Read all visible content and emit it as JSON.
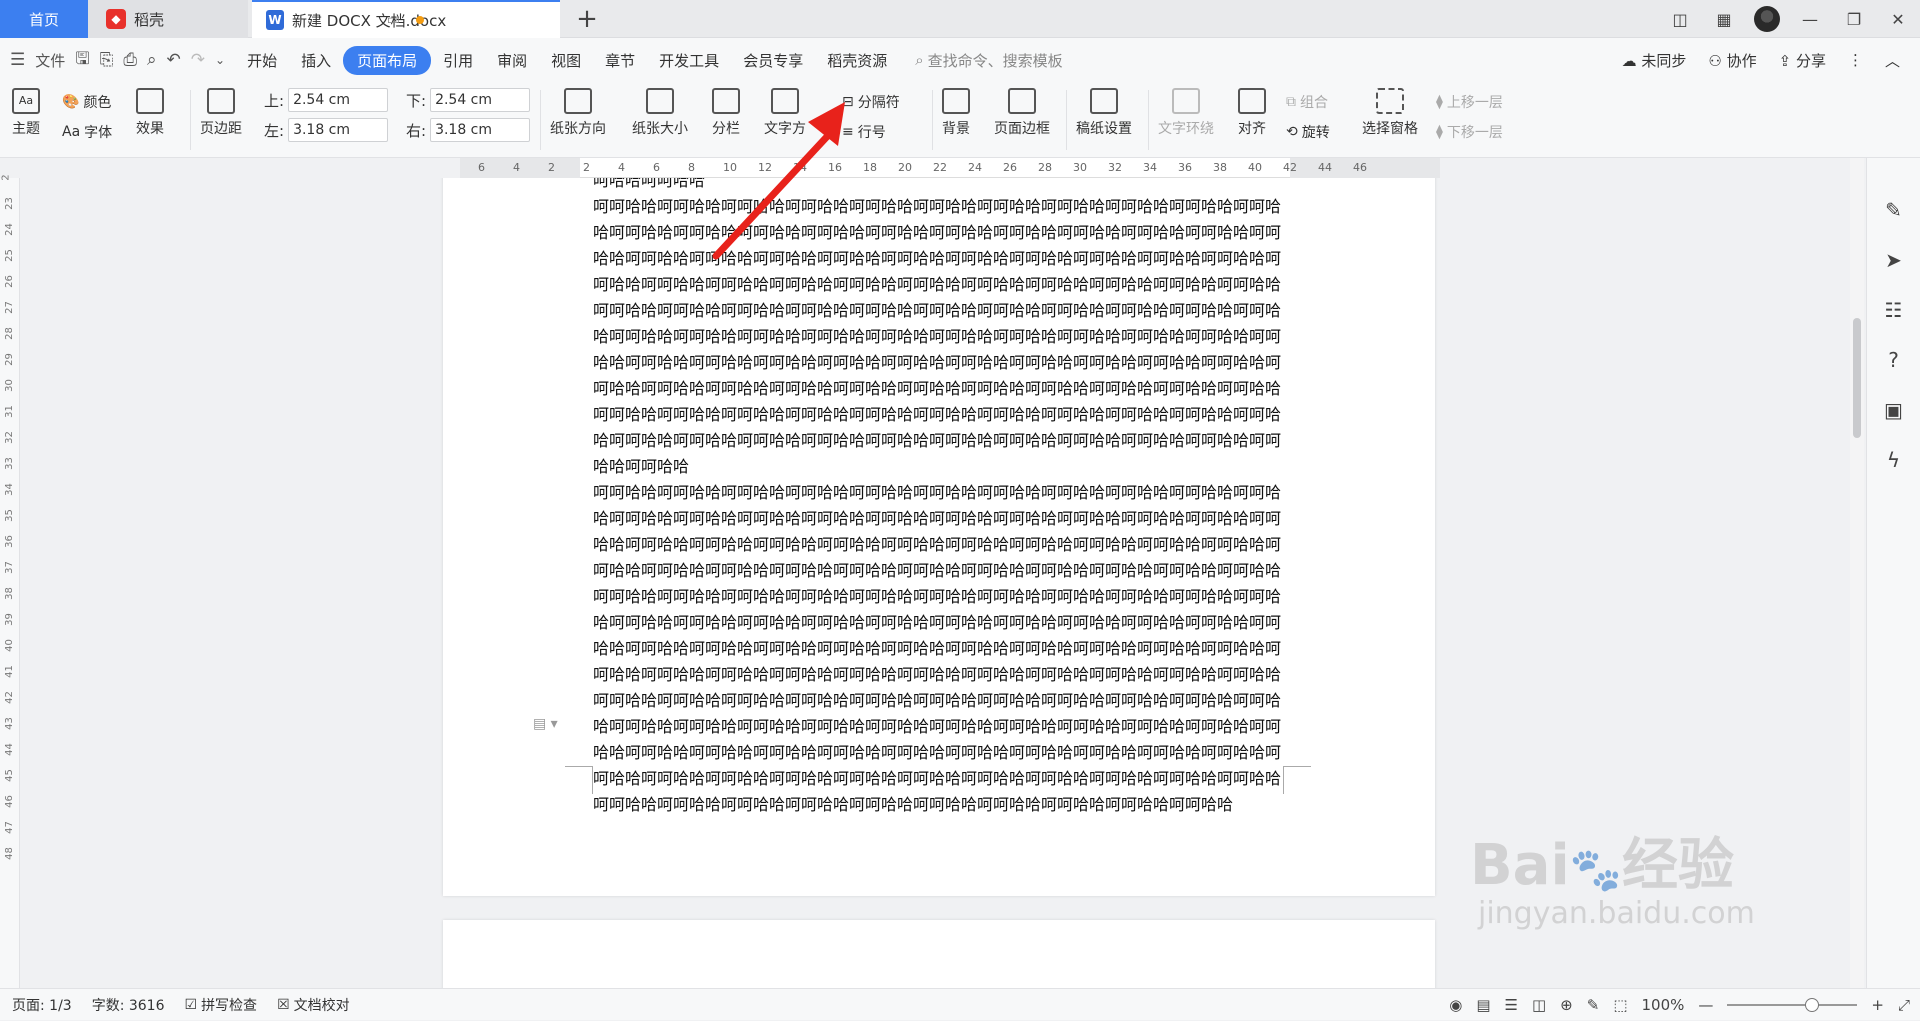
{
  "tabs": {
    "home": "首页",
    "daoke": "稻壳",
    "doc": "新建 DOCX 文档.docx",
    "add": "+"
  },
  "menu": {
    "file": "文件",
    "items": [
      "开始",
      "插入",
      "页面布局",
      "引用",
      "审阅",
      "视图",
      "章节",
      "开发工具",
      "会员专享",
      "稻壳资源"
    ],
    "active": "页面布局",
    "search_placeholder": "查找命令、搜索模板",
    "unsynced": "未同步",
    "collab": "协作",
    "share": "分享"
  },
  "ribbon": {
    "theme": "主题",
    "color": "颜色",
    "font": "字体",
    "effect": "效果",
    "margins": "页边距",
    "top_label": "上:",
    "top_value": "2.54 cm",
    "bottom_label": "下:",
    "bottom_value": "2.54 cm",
    "left_label": "左:",
    "left_value": "3.18 cm",
    "right_label": "右:",
    "right_value": "3.18 cm",
    "orientation": "纸张方向",
    "size": "纸张大小",
    "columns": "分栏",
    "text_dir": "文字方",
    "separator": "分隔符",
    "line_num": "行号",
    "background": "背景",
    "page_border": "页面边框",
    "grid_paper": "稿纸设置",
    "wrap": "文字环绕",
    "align": "对齐",
    "rotate": "旋转",
    "group": "组合",
    "select_pane": "选择窗格",
    "bring_forward": "上移一层",
    "send_backward": "下移一层"
  },
  "document": {
    "line0": "呵哈哈呵呵哈哈",
    "para1": "呵呵哈哈呵呵哈哈呵呵哈哈呵呵哈哈呵呵哈哈呵呵哈哈呵呵哈哈呵呵哈哈呵呵哈哈呵呵哈哈呵呵哈哈呵呵哈哈呵呵哈哈呵呵哈哈呵呵哈哈呵呵哈哈呵呵哈哈呵呵哈哈呵呵哈哈呵呵哈哈呵呵哈哈呵呵哈哈呵呵哈哈呵呵哈哈呵呵哈哈呵呵哈哈呵呵哈哈呵呵哈哈呵呵哈哈呵呵哈哈呵呵哈哈呵呵哈哈呵呵哈哈呵呵哈哈呵呵哈哈呵呵哈哈呵呵哈哈呵呵哈哈呵呵哈哈呵呵哈哈呵呵哈哈呵呵哈哈呵呵哈哈呵呵哈哈呵呵哈哈呵呵哈哈呵呵哈哈呵呵哈哈呵呵哈哈呵呵哈哈呵呵哈哈呵呵哈哈呵呵哈哈呵呵哈哈呵呵哈哈呵呵哈哈呵呵哈哈呵呵哈哈呵呵哈哈呵呵哈哈呵呵哈哈呵呵哈哈呵呵哈哈呵呵哈哈呵呵哈哈呵呵哈哈呵呵哈哈呵呵哈哈呵呵哈哈呵呵哈哈呵呵哈哈呵呵哈哈呵呵哈哈呵呵哈哈呵呵哈哈呵呵哈哈呵呵哈哈呵呵哈哈呵呵哈哈呵呵哈哈呵呵哈哈呵呵哈哈呵呵哈哈呵呵哈哈呵呵哈哈呵呵哈哈呵呵哈哈呵呵哈哈呵呵哈哈呵呵哈哈呵呵哈哈呵呵哈哈呵呵哈哈呵呵哈哈呵呵哈哈呵呵哈哈呵呵哈哈呵呵哈哈呵呵哈哈呵呵哈哈呵呵哈哈呵呵哈哈呵呵哈哈呵呵哈哈呵呵哈哈呵呵哈哈呵呵哈哈呵呵哈哈呵呵哈哈",
    "para2": "呵呵哈哈呵呵哈哈呵呵哈哈呵呵哈哈呵呵哈哈呵呵哈哈呵呵哈哈呵呵哈哈呵呵哈哈呵呵哈哈呵呵哈哈呵呵哈哈呵呵哈哈呵呵哈哈呵呵哈哈呵呵哈哈呵呵哈哈呵呵哈哈呵呵哈哈呵呵哈哈呵呵哈哈呵呵哈哈呵呵哈哈呵呵哈哈呵呵哈哈呵呵哈哈呵呵哈哈呵呵哈哈呵呵哈哈呵呵哈哈呵呵哈哈呵呵哈哈呵呵哈哈呵呵哈哈呵呵哈哈呵呵哈哈呵呵哈哈呵呵哈哈呵呵哈哈呵呵哈哈呵呵哈哈呵呵哈哈呵呵哈哈呵呵哈哈呵呵哈哈呵呵哈哈呵呵哈哈呵呵哈哈呵呵哈哈呵呵哈哈呵呵哈哈呵呵哈哈呵呵哈哈呵呵哈哈呵呵哈哈呵呵哈哈呵呵哈哈呵呵哈哈呵呵哈哈呵呵哈哈呵呵哈哈呵呵哈哈呵呵哈哈呵呵哈哈呵呵哈哈呵呵哈哈呵呵哈哈呵呵哈哈呵呵哈哈呵呵哈哈呵呵哈哈呵呵哈哈呵呵哈哈呵呵哈哈呵呵哈哈呵呵哈哈呵呵哈哈呵呵哈哈呵呵哈哈呵呵哈哈呵呵哈哈呵呵哈哈呵呵哈哈呵呵哈哈呵呵哈哈呵呵哈哈呵呵哈哈呵呵哈哈呵呵哈哈呵呵哈哈呵呵哈哈呵呵哈哈呵呵哈哈呵呵哈哈呵呵哈哈呵呵哈哈呵呵哈哈呵呵哈哈呵呵哈哈呵呵哈哈呵呵哈哈呵呵哈哈呵呵哈哈呵呵哈哈呵呵哈哈呵呵哈哈呵呵哈哈呵呵哈哈呵呵哈哈呵呵哈哈呵呵哈哈呵呵哈哈呵呵哈哈呵呵哈哈呵呵哈哈呵呵哈哈呵呵哈哈呵呵哈哈呵呵哈哈呵呵哈哈呵呵哈哈呵呵哈哈呵呵哈哈呵呵哈哈呵呵哈哈呵呵哈哈呵呵哈哈呵呵哈哈呵呵哈哈呵呵哈哈呵呵哈哈呵呵哈哈呵呵哈哈呵呵哈哈呵呵哈哈呵呵哈哈呵呵哈哈呵呵哈哈呵呵哈哈"
  },
  "ruler_h": [
    "6",
    "4",
    "2",
    "2",
    "4",
    "6",
    "8",
    "10",
    "12",
    "14",
    "16",
    "18",
    "20",
    "22",
    "24",
    "26",
    "28",
    "30",
    "32",
    "34",
    "36",
    "38",
    "40",
    "42",
    "44",
    "46"
  ],
  "ruler_v": [
    "2",
    "23",
    "24",
    "25",
    "26",
    "27",
    "28",
    "29",
    "30",
    "31",
    "32",
    "33",
    "34",
    "35",
    "36",
    "37",
    "38",
    "39",
    "40",
    "41",
    "42",
    "43",
    "44",
    "45",
    "46",
    "47",
    "48"
  ],
  "status": {
    "page": "页面: 1/3",
    "words": "字数: 3616",
    "spell": "拼写检查",
    "proof": "文档校对",
    "zoom": "100%"
  },
  "watermark": {
    "brand": "Bai",
    "jingyan": "经验",
    "url": "jingyan.baidu.com"
  },
  "colors": {
    "accent": "#3c7ff0",
    "arrow": "#e8221b"
  }
}
